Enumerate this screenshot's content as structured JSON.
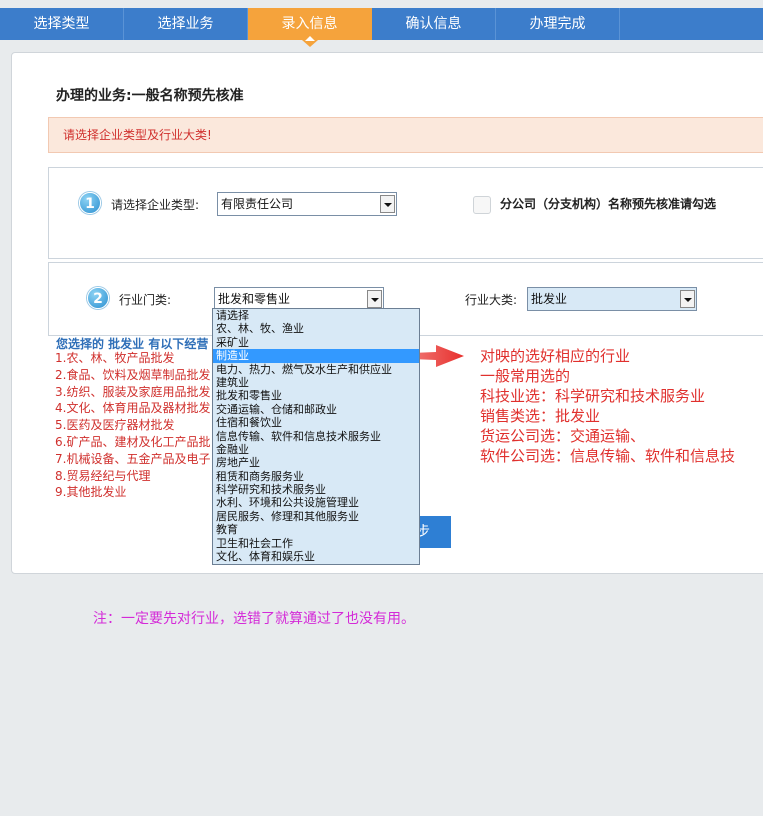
{
  "steps": [
    "选择类型",
    "选择业务",
    "录入信息",
    "确认信息",
    "办理完成"
  ],
  "active_step": 2,
  "business_title": "办理的业务:一般名称预先核准",
  "alert_text": "请选择企业类型及行业大类!",
  "section1": {
    "number": "1",
    "label": "请选择企业类型:",
    "selected": "有限责任公司",
    "branch_label": "分公司（分支机构）名称预先核准请勾选"
  },
  "section2": {
    "number": "2",
    "industry_label": "行业门类:",
    "industry_selected": "批发和零售业",
    "category_label": "行业大类:",
    "category_selected": "批发业"
  },
  "dropdown_options": [
    "请选择",
    "农、林、牧、渔业",
    "采矿业",
    "制造业",
    "电力、热力、燃气及水生产和供应业",
    "建筑业",
    "批发和零售业",
    "交通运输、仓储和邮政业",
    "住宿和餐饮业",
    "信息传输、软件和信息技术服务业",
    "金融业",
    "房地产业",
    "租赁和商务服务业",
    "科学研究和技术服务业",
    "水利、环境和公共设施管理业",
    "居民服务、修理和其他服务业",
    "教育",
    "卫生和社会工作",
    "文化、体育和娱乐业"
  ],
  "dropdown_highlighted": 3,
  "scope": {
    "title": "您选择的 批发业 有以下经营",
    "items": [
      "1.农、林、牧产品批发",
      "2.食品、饮料及烟草制品批发",
      "3.纺织、服装及家庭用品批发",
      "4.文化、体育用品及器材批发",
      "5.医药及医疗器材批发",
      "6.矿产品、建材及化工产品批",
      "7.机械设备、五金产品及电子",
      "8.贸易经纪与代理",
      "9.其他批发业"
    ]
  },
  "next_button_partial": "步",
  "annotation_lines": [
    "对映的选好相应的行业",
    "一般常用选的",
    "科技业选：科学研究和技术服务业",
    "销售类选：批发业",
    "货运公司选：交通运输、",
    "软件公司选：信息传输、软件和信息技"
  ],
  "note": "注：一定要先对行业，选错了就算通过了也没有用。",
  "colors": {
    "stepbar": "#3c7dcb",
    "active_step": "#f5a33c",
    "alert_text": "#d0302d",
    "annotation": "#e0302d",
    "note": "#d42ad8"
  }
}
